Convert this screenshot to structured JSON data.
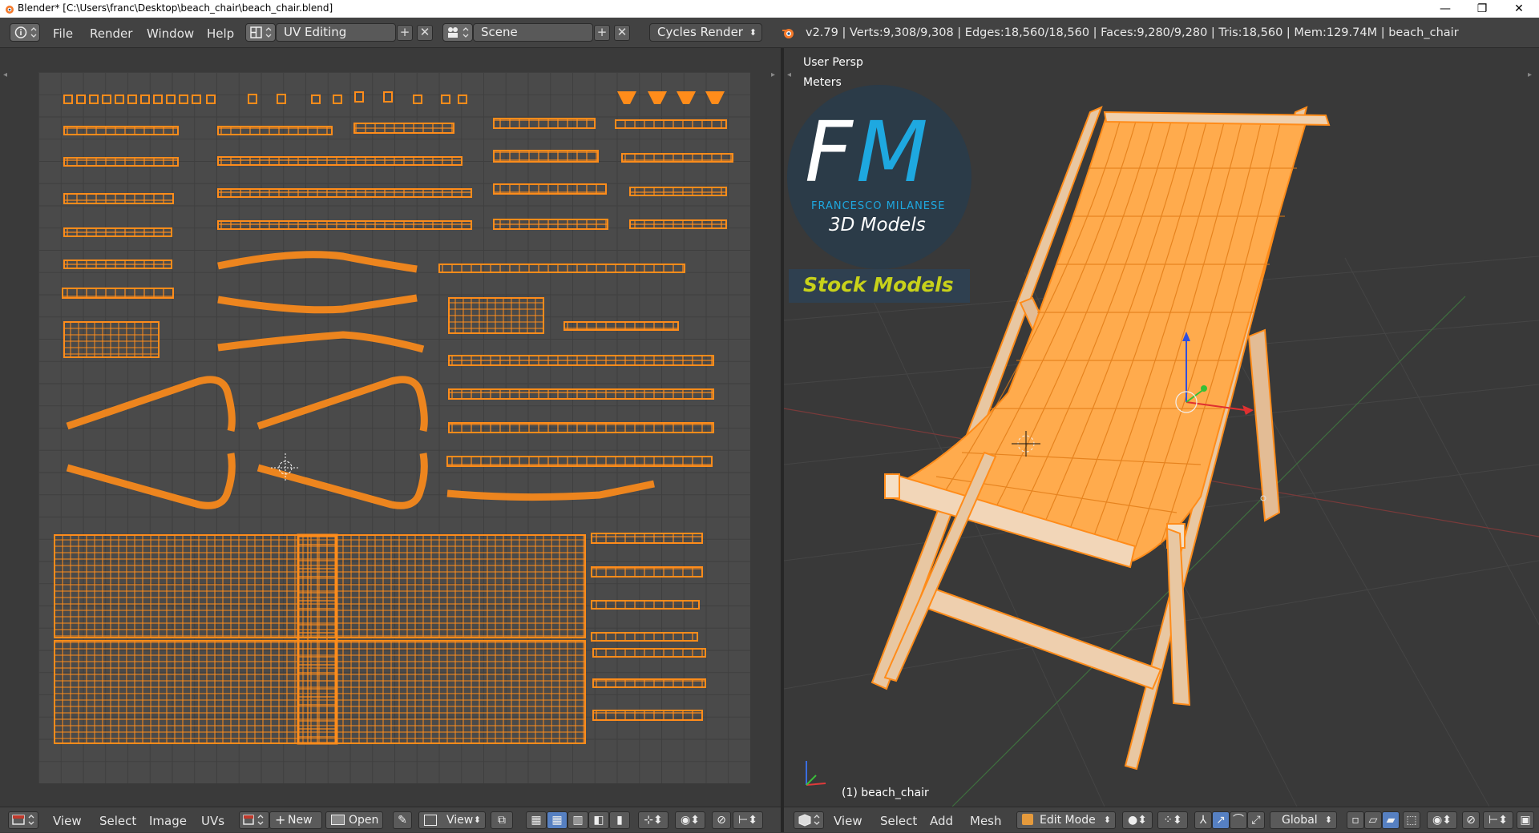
{
  "window": {
    "title": "Blender* [C:\\Users\\franc\\Desktop\\beach_chair\\beach_chair.blend]",
    "minimize": "—",
    "restore": "❐",
    "close": "✕"
  },
  "topbar": {
    "menus": [
      "File",
      "Render",
      "Window",
      "Help"
    ],
    "screen_layout": "UV Editing",
    "scene": "Scene",
    "render_engine": "Cycles Render",
    "stats": "v2.79 | Verts:9,308/9,308 | Edges:18,560/18,560 | Faces:9,280/9,280 | Tris:18,560 | Mem:129.74M | beach_chair"
  },
  "uv_editor": {
    "menus": [
      "View",
      "Select",
      "Image",
      "UVs"
    ],
    "new_label": "New",
    "open_label": "Open",
    "view_label": "View"
  },
  "viewport": {
    "view_name": "User Persp",
    "units": "Meters",
    "object_label": "(1) beach_chair",
    "menus": [
      "View",
      "Select",
      "Add",
      "Mesh"
    ],
    "mode": "Edit Mode",
    "orientation": "Global",
    "logo": {
      "letters_f": "F",
      "letters_m": "M",
      "author": "FRANCESCO MILANESE",
      "tagline": "3D Models",
      "stock": "Stock Models"
    }
  },
  "colors": {
    "accent_orange": "#ff9a2e",
    "logo_blue": "#1ea8e0",
    "stock_yellow": "#c8d21a",
    "panel_bg": "#424242"
  }
}
